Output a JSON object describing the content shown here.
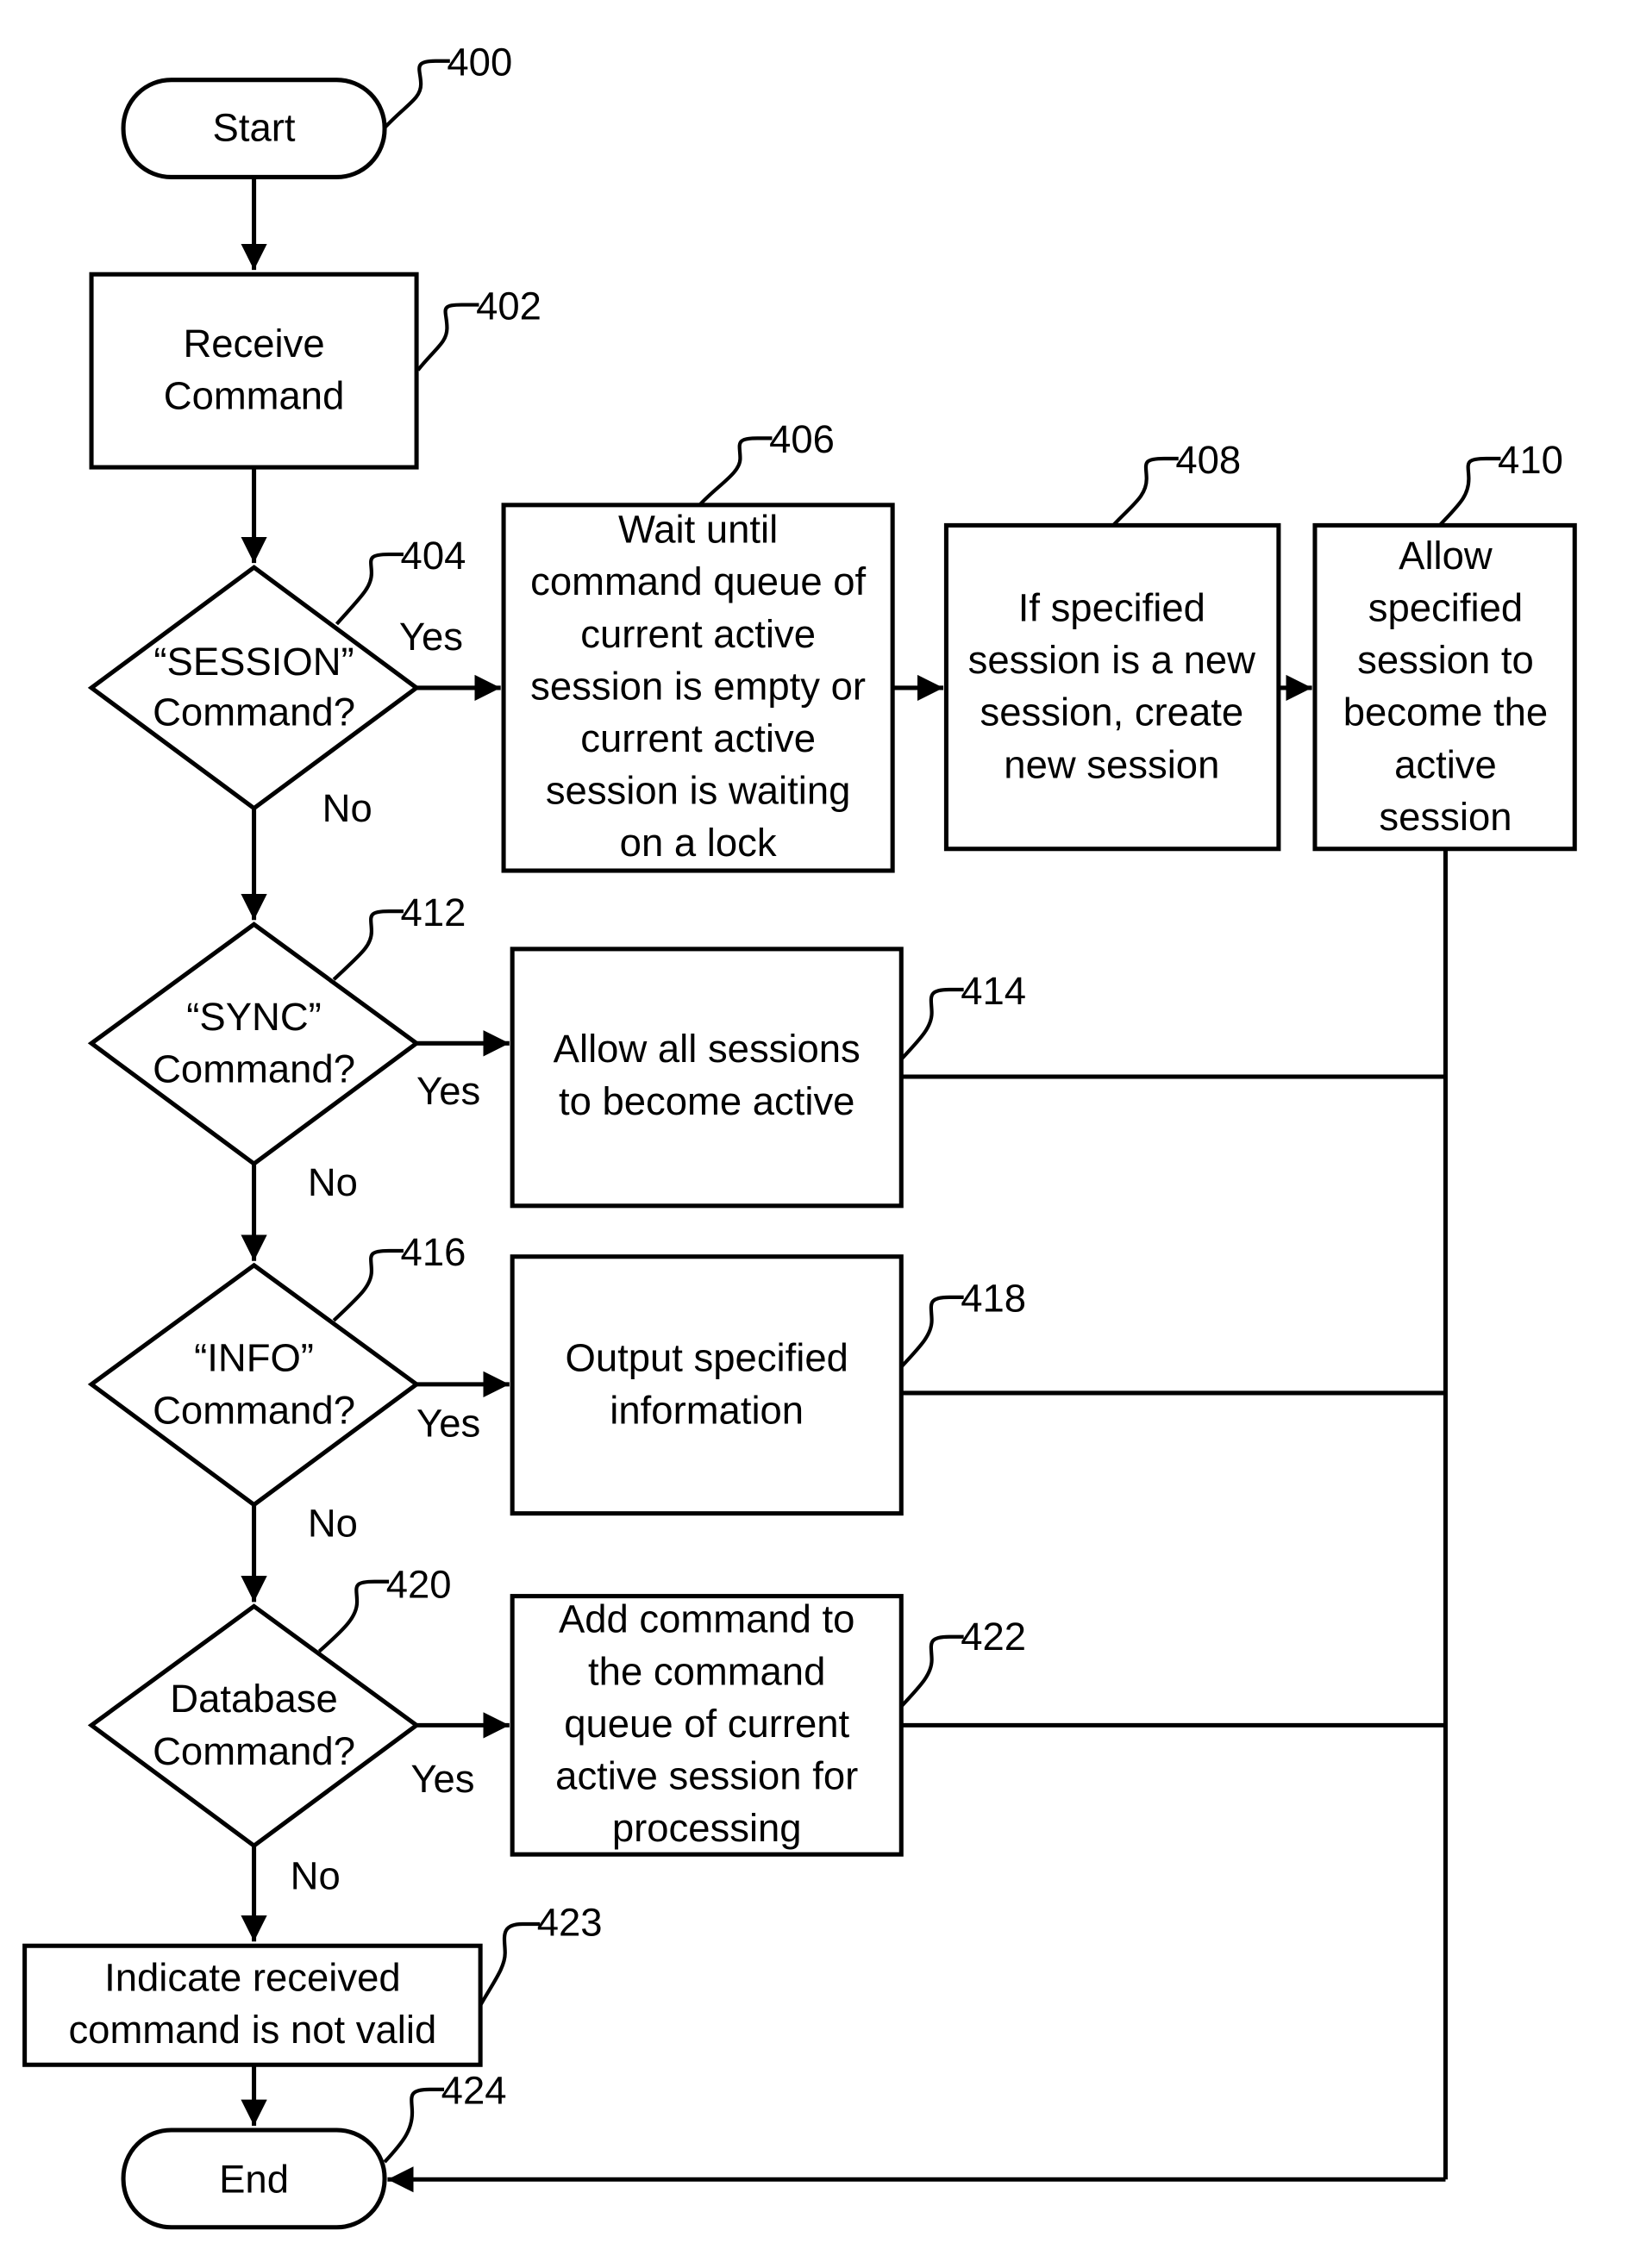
{
  "figure": {
    "type": "flowchart",
    "nodes": {
      "start": {
        "ref": "400",
        "lines": [
          "Start"
        ]
      },
      "receive": {
        "ref": "402",
        "lines": [
          "Receive",
          "Command"
        ]
      },
      "session_dec": {
        "ref": "404",
        "lines": [
          "“SESSION”",
          "Command?"
        ]
      },
      "wait": {
        "ref": "406",
        "lines": [
          "Wait until",
          "command queue of",
          "current active",
          "session is empty or",
          "current active",
          "session is waiting",
          "on a lock"
        ]
      },
      "create": {
        "ref": "408",
        "lines": [
          "If specified",
          "session is a new",
          "session, create",
          "new session"
        ]
      },
      "allow": {
        "ref": "410",
        "lines": [
          "Allow",
          "specified",
          "session to",
          "become the",
          "active",
          "session"
        ]
      },
      "sync_dec": {
        "ref": "412",
        "lines": [
          "“SYNC”",
          "Command?"
        ]
      },
      "allow_all": {
        "ref": "414",
        "lines": [
          "Allow all sessions",
          "to become active"
        ]
      },
      "info_dec": {
        "ref": "416",
        "lines": [
          "“INFO”",
          "Command?"
        ]
      },
      "output": {
        "ref": "418",
        "lines": [
          "Output specified",
          "information"
        ]
      },
      "db_dec": {
        "ref": "420",
        "lines": [
          "Database",
          "Command?"
        ]
      },
      "add_cmd": {
        "ref": "422",
        "lines": [
          "Add command to",
          "the command",
          "queue of current",
          "active session for",
          "processing"
        ]
      },
      "invalid": {
        "ref": "423",
        "lines": [
          "Indicate received",
          "command is not valid"
        ]
      },
      "end": {
        "ref": "424",
        "lines": [
          "End"
        ]
      }
    },
    "branch_labels": {
      "yes": "Yes",
      "no": "No"
    }
  }
}
